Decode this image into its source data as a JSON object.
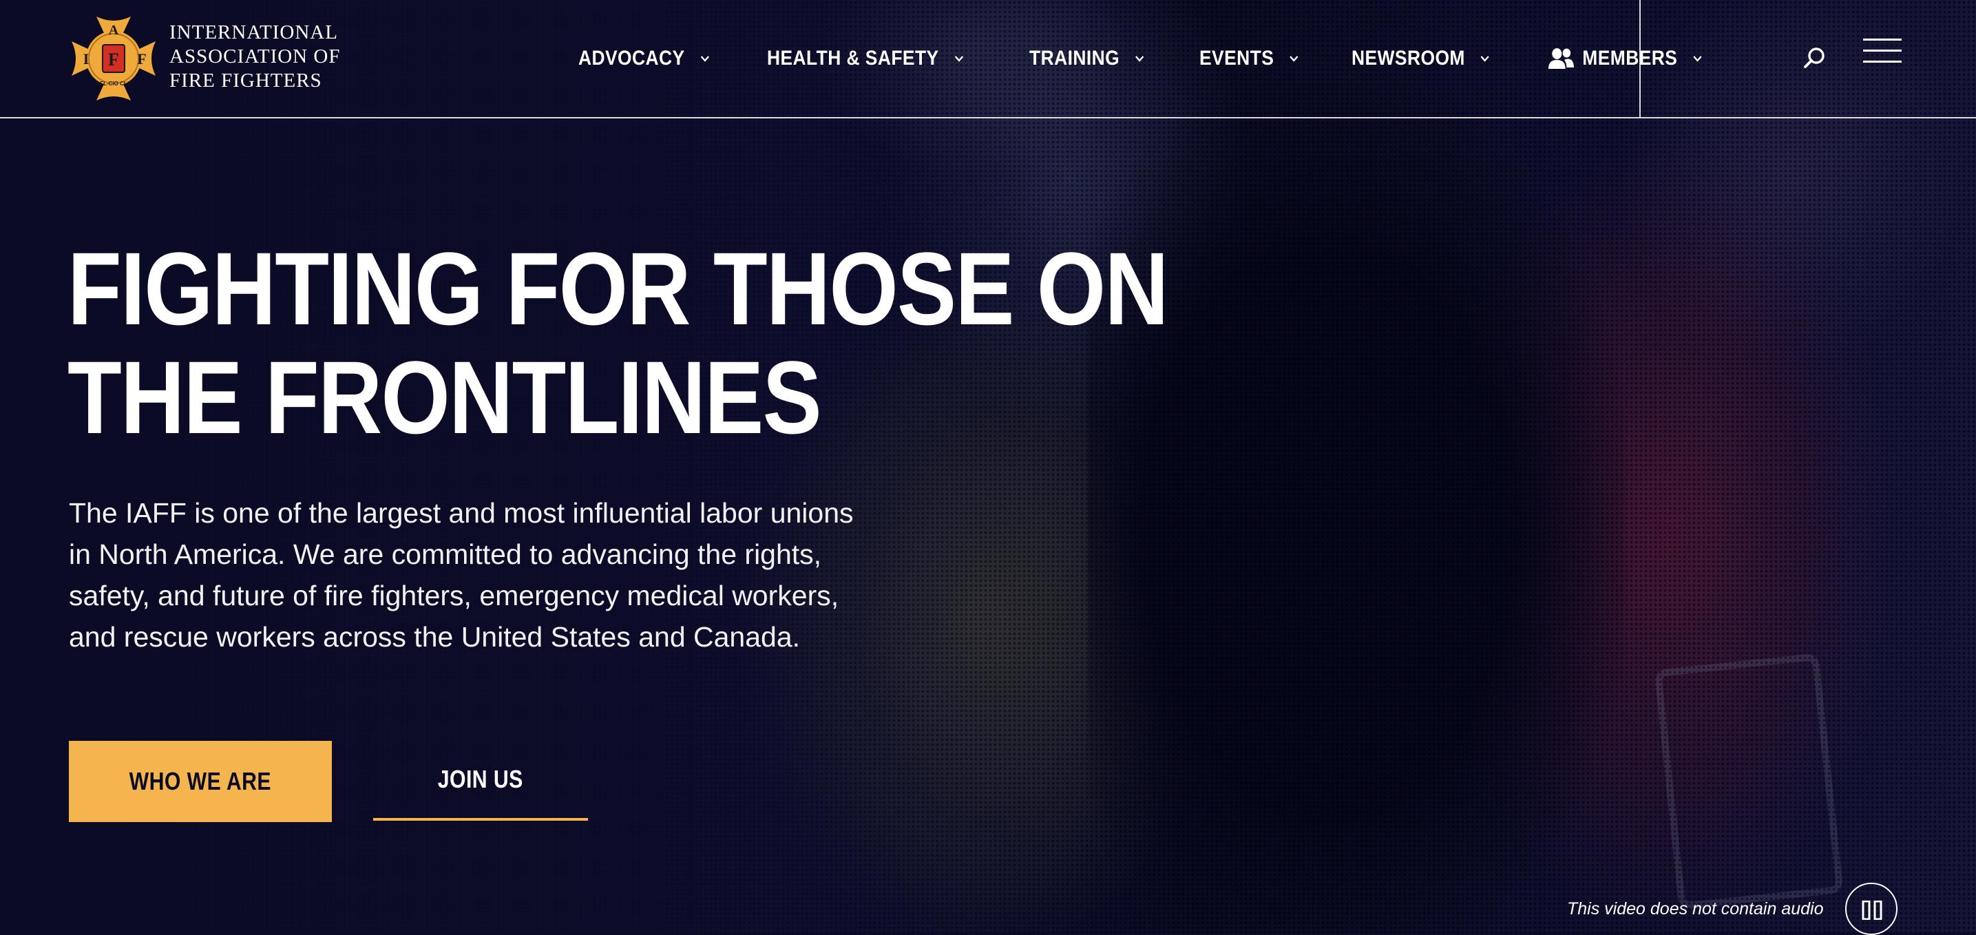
{
  "brand": {
    "logo_badge": {
      "top": "A",
      "left": "I",
      "center": "F",
      "right": "F",
      "bottom": "AFL-CIO CLC"
    },
    "logo_lines": [
      "INTERNATIONAL",
      "ASSOCIATION OF",
      "FIRE FIGHTERS"
    ]
  },
  "nav": {
    "items": [
      {
        "label": "ADVOCACY",
        "icon": "chevron-down-icon"
      },
      {
        "label": "HEALTH & SAFETY",
        "icon": "chevron-down-icon"
      },
      {
        "label": "TRAINING",
        "icon": "chevron-down-icon"
      },
      {
        "label": "EVENTS",
        "icon": "chevron-down-icon"
      },
      {
        "label": "NEWSROOM",
        "icon": "chevron-down-icon"
      },
      {
        "label": "MEMBERS",
        "icon": "users-icon"
      }
    ],
    "search_icon": "search-icon",
    "menu_icon": "hamburger-menu-icon"
  },
  "hero": {
    "title_lines": [
      "FIGHTING FOR THOSE ON",
      "THE FRONTLINES"
    ],
    "description": "The IAFF is one of the largest and most influential labor unions in North America. We are committed to advancing the rights, safety, and future of fire fighters, emergency medical workers, and rescue workers across the United States and Canada.",
    "primary_button": "WHO WE ARE",
    "secondary_button": "JOIN US",
    "video_note": "This video does not contain audio",
    "pause_icon": "pause-icon"
  },
  "colors": {
    "background": "#0b0b26",
    "accent": "#f4b54f",
    "logo_gold": "#f0a93b",
    "logo_red": "#d32f24",
    "text": "#ffffff"
  }
}
